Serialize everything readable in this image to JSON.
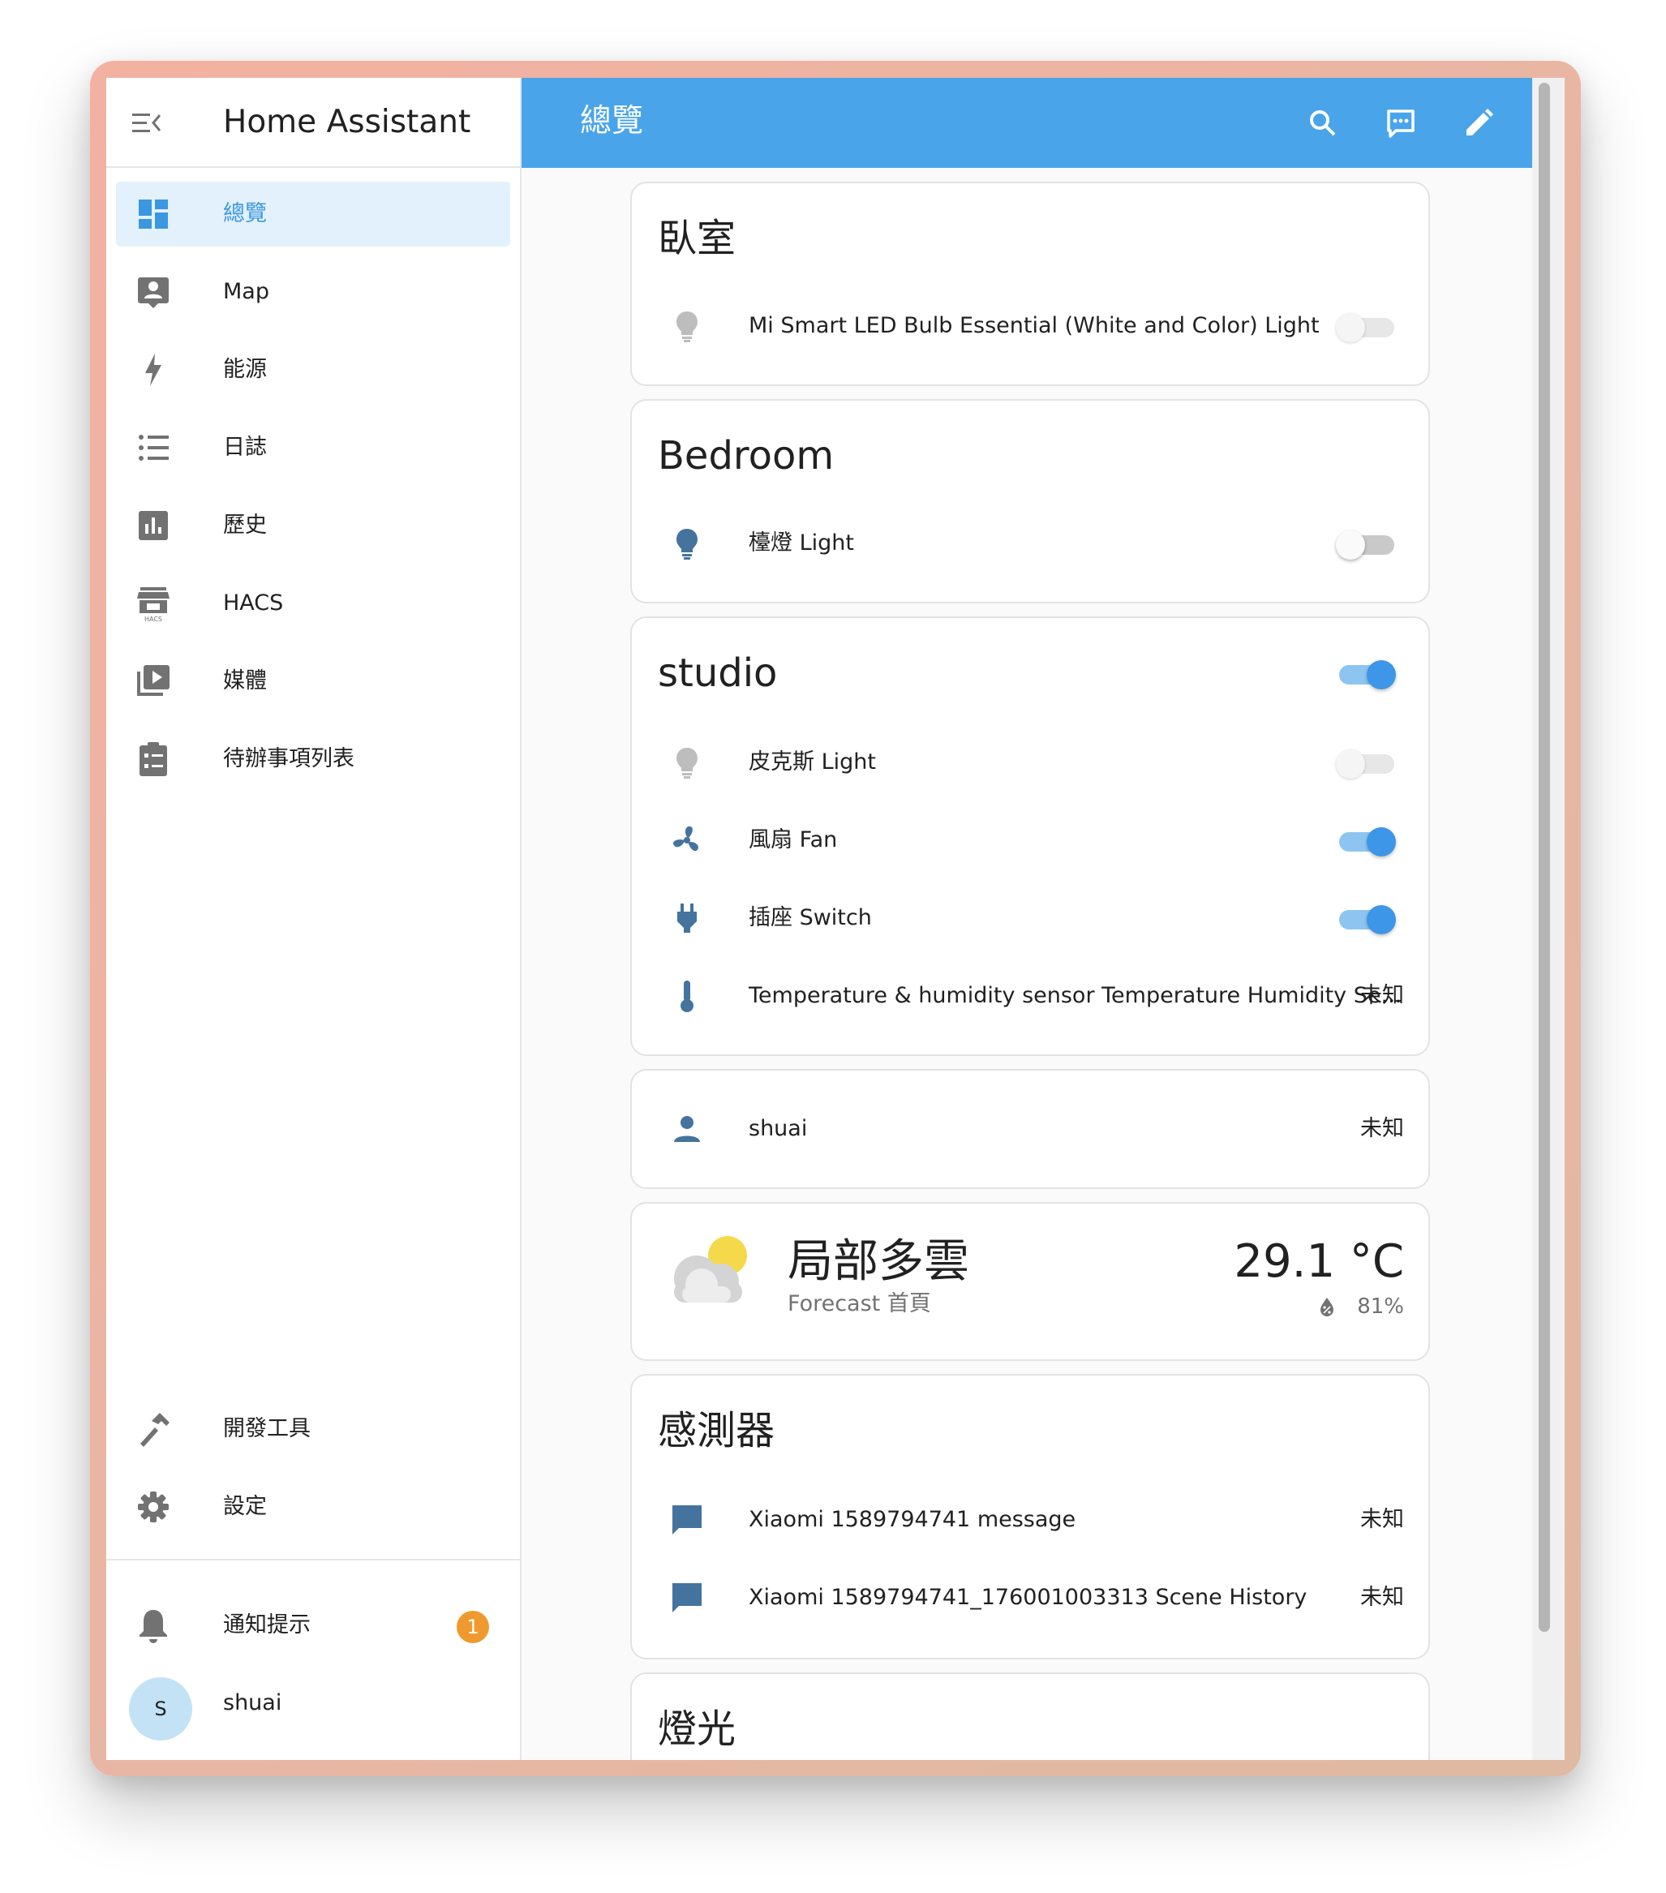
{
  "app": {
    "title": "Home Assistant"
  },
  "toolbar": {
    "title": "總覽",
    "search_icon": "search-icon",
    "assist_icon": "assist-icon",
    "edit_icon": "pencil-icon"
  },
  "sidebar": {
    "items": [
      {
        "label": "總覽",
        "icon": "dashboard-icon",
        "active": true
      },
      {
        "label": "Map",
        "icon": "map-account-icon"
      },
      {
        "label": "能源",
        "icon": "lightning-bolt-icon"
      },
      {
        "label": "日誌",
        "icon": "logbook-icon"
      },
      {
        "label": "歷史",
        "icon": "history-chart-icon"
      },
      {
        "label": "HACS",
        "icon": "hacs-icon"
      },
      {
        "label": "媒體",
        "icon": "media-icon"
      },
      {
        "label": "待辦事項列表",
        "icon": "todo-list-icon"
      }
    ],
    "bottom_items": [
      {
        "label": "開發工具",
        "icon": "hammer-icon"
      },
      {
        "label": "設定",
        "icon": "gear-icon"
      }
    ],
    "notifications": {
      "label": "通知提示",
      "count": "1"
    },
    "user": {
      "name": "shuai",
      "initial": "S"
    }
  },
  "cards": {
    "bedroom_zh": {
      "title": "臥室",
      "rows": [
        {
          "label": "Mi Smart LED Bulb Essential (White and Color) Light",
          "state": "unavailable"
        }
      ]
    },
    "bedroom": {
      "title": "Bedroom",
      "rows": [
        {
          "label": "檯燈 Light",
          "state": "off"
        }
      ]
    },
    "studio": {
      "title": "studio",
      "header_toggle": "on",
      "rows": [
        {
          "label": "皮克斯 Light",
          "state": "unavailable"
        },
        {
          "label": "風扇 Fan",
          "state": "on"
        },
        {
          "label": "插座 Switch",
          "state": "on"
        },
        {
          "label": "Temperature & humidity sensor Temperature Humidity Se...",
          "value": "未知"
        }
      ]
    },
    "person": {
      "rows": [
        {
          "label": "shuai",
          "value": "未知"
        }
      ]
    },
    "weather": {
      "state": "局部多雲",
      "name": "Forecast 首頁",
      "temperature": "29.1 °C",
      "humidity": "81%"
    },
    "sensors": {
      "title": "感測器",
      "rows": [
        {
          "label": "Xiaomi 1589794741 message",
          "value": "未知"
        },
        {
          "label": "Xiaomi 1589794741_176001003313 Scene History",
          "value": "未知"
        }
      ]
    },
    "lights": {
      "title": "燈光"
    }
  },
  "colors": {
    "toolbar": "#49a4ea",
    "accent": "#3d96e8",
    "icon": "#44739e",
    "badge": "#ef9a2e"
  }
}
